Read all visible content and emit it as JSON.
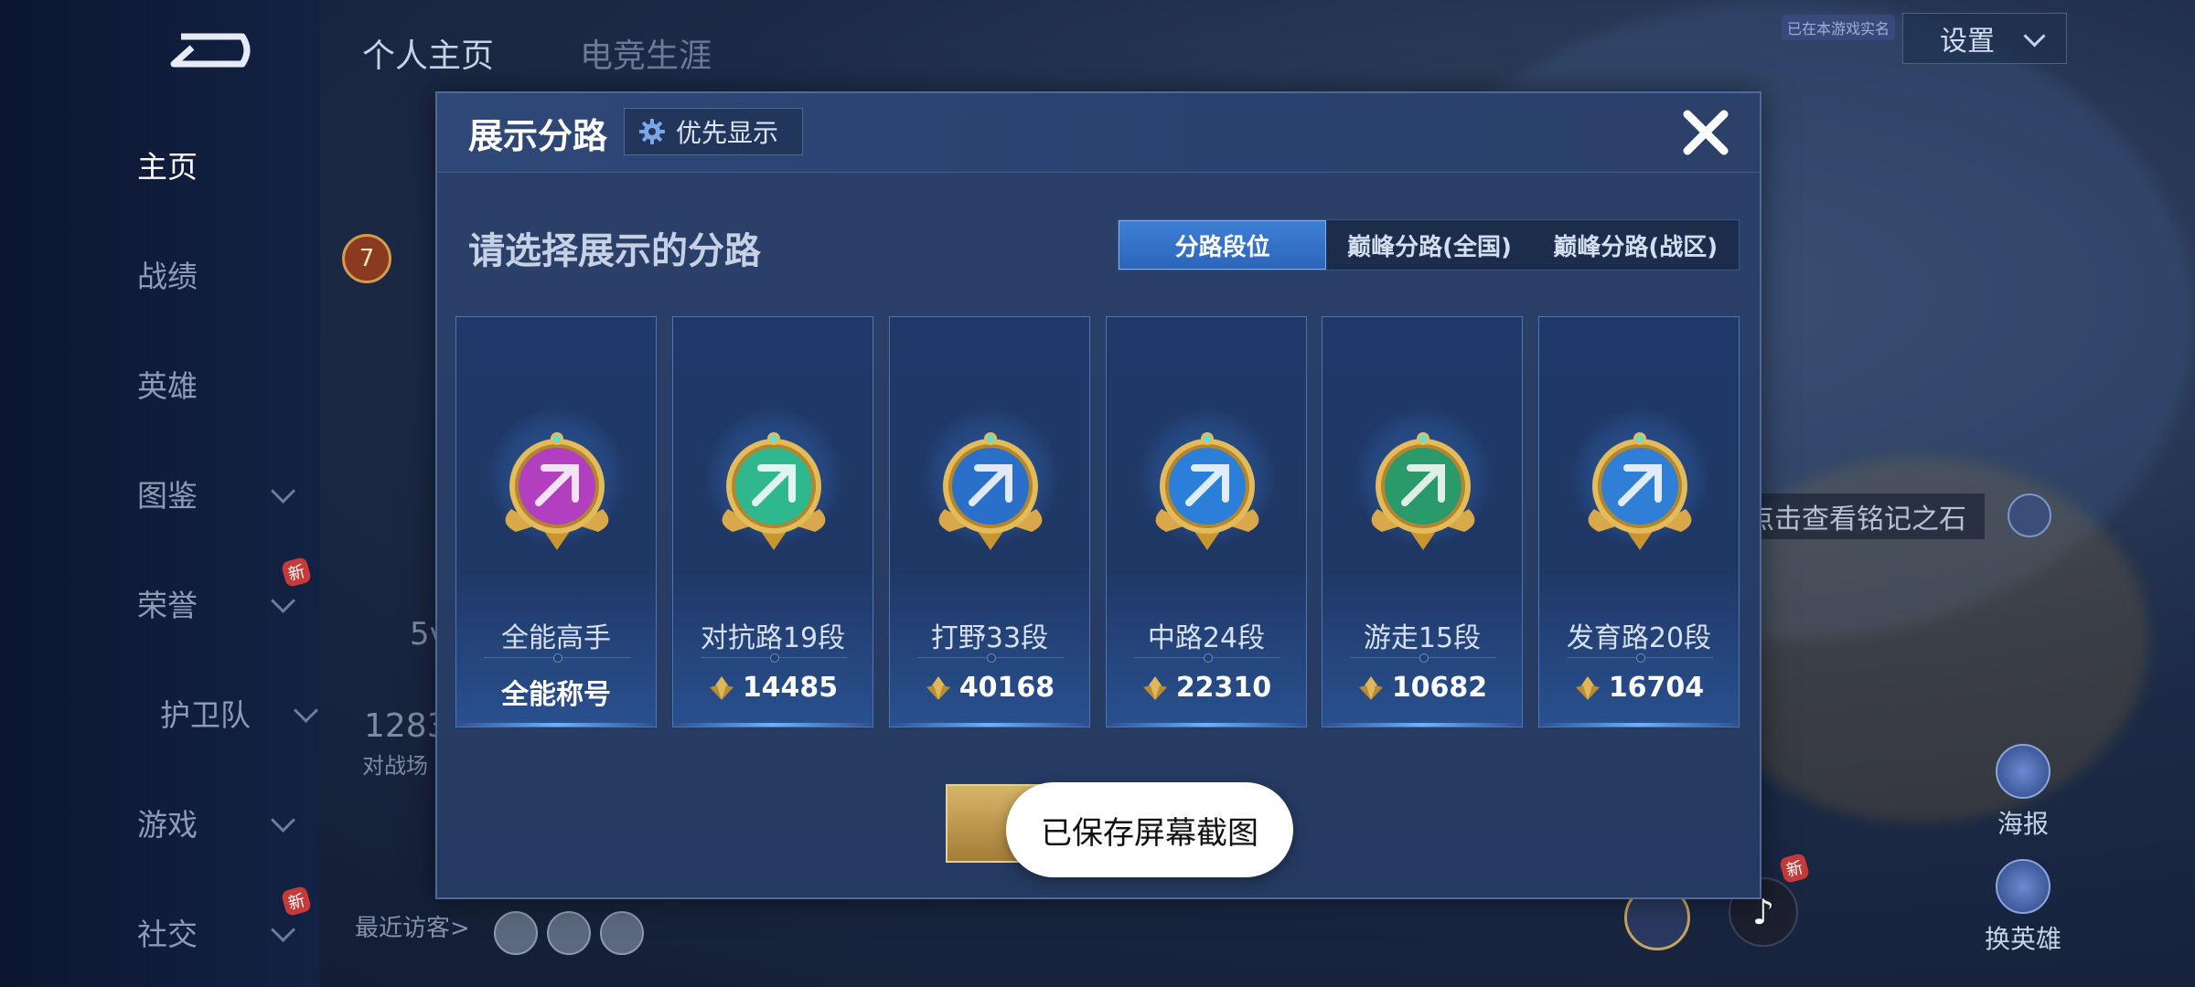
{
  "sidebar": {
    "items": [
      {
        "label": "主页",
        "active": true,
        "chevron": false,
        "new": false
      },
      {
        "label": "战绩",
        "active": false,
        "chevron": false,
        "new": false
      },
      {
        "label": "英雄",
        "active": false,
        "chevron": false,
        "new": false
      },
      {
        "label": "图鉴",
        "active": false,
        "chevron": true,
        "new": false
      },
      {
        "label": "荣誉",
        "active": false,
        "chevron": true,
        "new": true
      },
      {
        "label": "护卫队",
        "active": false,
        "chevron": true,
        "new": false
      },
      {
        "label": "游戏",
        "active": false,
        "chevron": true,
        "new": false
      },
      {
        "label": "社交",
        "active": false,
        "chevron": true,
        "new": true
      }
    ],
    "new_tag": "新"
  },
  "header": {
    "tabs": [
      "个人主页",
      "电竞生涯"
    ],
    "settings_label": "设置",
    "settings_hint": "已在本游戏实名"
  },
  "background": {
    "level_badge": "7",
    "stat_text": "5v",
    "count_text": "1283",
    "count_sub": "对战场",
    "rune_hint": "点击查看铭记之石",
    "poster_label": "海报",
    "change_hero_label": "换英雄",
    "new_tag": "新",
    "recent_visitors_label": "最近访客>"
  },
  "modal": {
    "title": "展示分路",
    "priority_label": "优先显示",
    "subtitle": "请选择展示的分路",
    "segments": [
      "分路段位",
      "巅峰分路(全国)",
      "巅峰分路(战区)"
    ],
    "active_segment": 0,
    "cards": [
      {
        "name": "全能高手",
        "value": "全能称号",
        "has_icon": false,
        "color": "#b23fbf",
        "icon": "all-round-badge-icon"
      },
      {
        "name": "对抗路19段",
        "value": "14485",
        "has_icon": true,
        "color": "#2fb88e",
        "icon": "clash-lane-badge-icon"
      },
      {
        "name": "打野33段",
        "value": "40168",
        "has_icon": true,
        "color": "#2a6fc9",
        "icon": "jungle-badge-icon"
      },
      {
        "name": "中路24段",
        "value": "22310",
        "has_icon": true,
        "color": "#2c7fd8",
        "icon": "mid-lane-badge-icon"
      },
      {
        "name": "游走15段",
        "value": "10682",
        "has_icon": true,
        "color": "#2a9a6b",
        "icon": "roam-badge-icon"
      },
      {
        "name": "发育路20段",
        "value": "16704",
        "has_icon": true,
        "color": "#2f7fd6",
        "icon": "farm-lane-badge-icon"
      }
    ]
  },
  "toast": {
    "text": "已保存屏幕截图"
  },
  "colors": {
    "accent": "#3d7fd6",
    "gold": "#d8b46a",
    "panel": "#253a61"
  }
}
